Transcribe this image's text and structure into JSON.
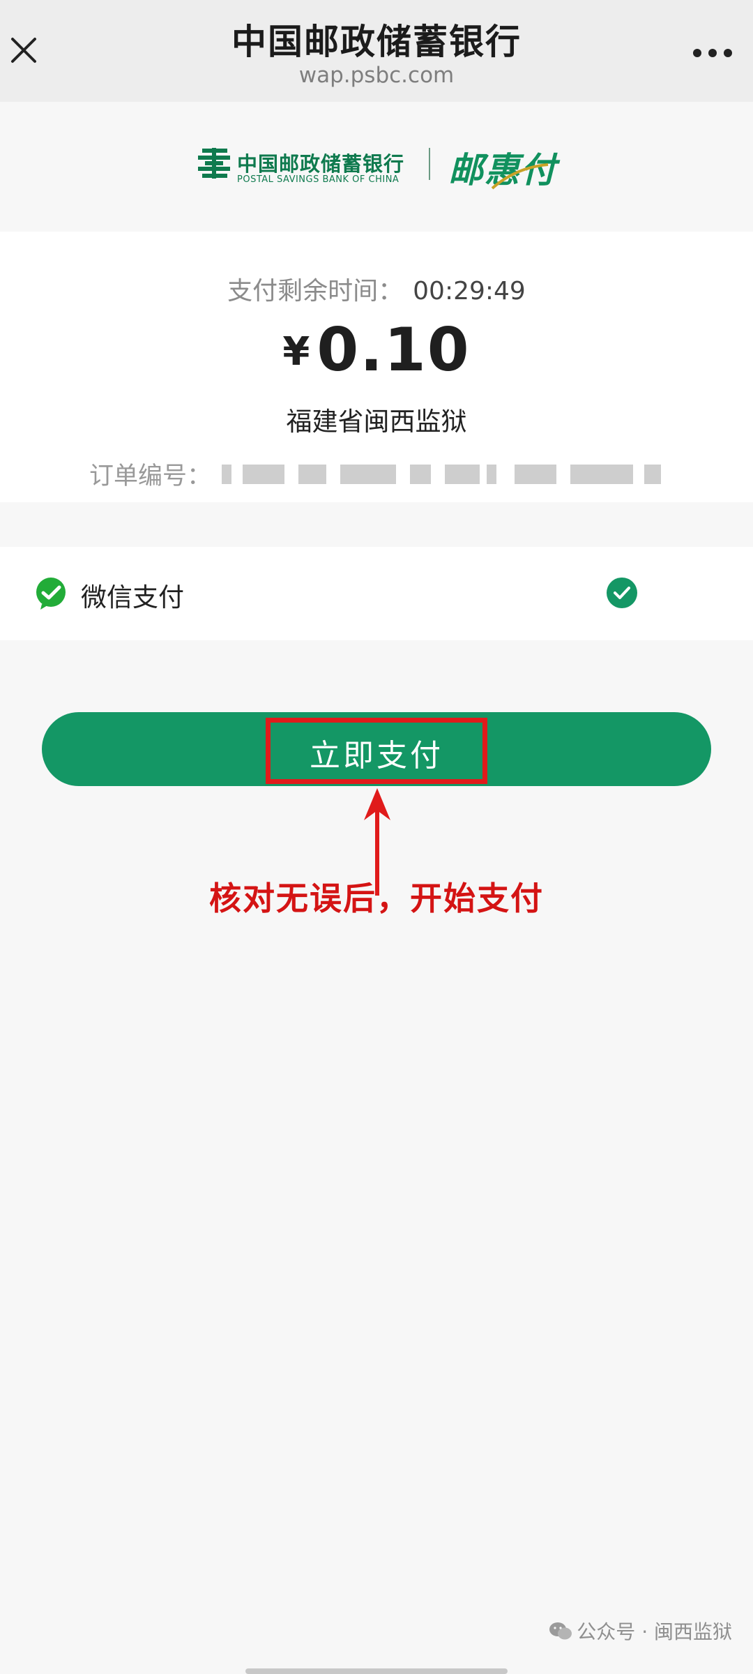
{
  "topbar": {
    "title": "中国邮政储蓄银行",
    "url": "wap.psbc.com",
    "close_icon": "close-icon",
    "more_icon": "more-dots-icon"
  },
  "logo": {
    "name_cn": "中国邮政储蓄银行",
    "name_en": "POSTAL SAVINGS BANK OF CHINA",
    "brand": "邮惠付",
    "brand_color": "#11915e"
  },
  "payment": {
    "countdown_label": "支付剩余时间：",
    "countdown_time": "00:29:49",
    "currency_symbol": "¥",
    "amount": "0.10",
    "merchant": "福建省闽西监狱",
    "order_label": "订单编号："
  },
  "method": {
    "label": "微信支付",
    "icon": "wechat-pay-icon",
    "selected": true,
    "accent": "#149765"
  },
  "pay_button": {
    "label": "立即支付",
    "color": "#149765"
  },
  "annotation": {
    "text": "核对无误后，开始支付",
    "color": "#d41414"
  },
  "watermark": {
    "text": "公众号 · 闽西监狱"
  }
}
